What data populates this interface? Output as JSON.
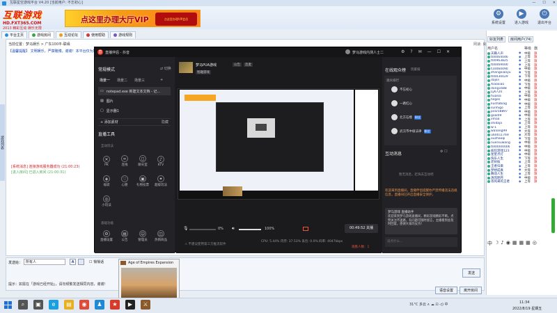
{
  "app": {
    "title": "互联星空游戏平台 V4.20 [当前用户: 不忘初心]",
    "logo_main": "互联游戏",
    "logo_sub": "HD.FXT365.COM",
    "logo_tag": "2013 精彩互动 娱乐无限",
    "vip_banner": "点这里办理大厅VIP",
    "vip_ribbon": "点这里办理VIP会员",
    "win_controls": [
      "—",
      "☐",
      "✕"
    ],
    "top_tools": [
      {
        "label": "系统设置",
        "icon": "⚙"
      },
      {
        "label": "进入游戏",
        "icon": "▶"
      },
      {
        "label": "退出平台",
        "icon": "⏻"
      }
    ]
  },
  "nav_tabs": [
    {
      "label": "平台主页",
      "color": "#2a8de0"
    },
    {
      "label": "游戏房间",
      "color": "#3aa34a"
    },
    {
      "label": "互动论坛",
      "color": "#e8a020"
    },
    {
      "label": "使用帮助",
      "color": "#d23a3a"
    },
    {
      "label": "游戏规则",
      "color": "#7a57c0"
    }
  ],
  "room": {
    "info": "当前位置：梦马娱乐 > 广东100平-联缘",
    "notice": "【温馨提醒】 文明娱乐，严禁赌博，谢谢！本平台仅为娱乐平台...",
    "chat_line1": "[系统消息] 连接游戏服务器成功 (21:00:23)",
    "chat_line2": "[进入房间] 已进入房间 (21:00:31)",
    "ping": "网速: 良",
    "left_strip": "游戏列表"
  },
  "send": {
    "to_label": "发送给：",
    "to_value": "所有人",
    "format_label": "A",
    "private_label": "悄悄话",
    "send_label": "发送",
    "tip": "提示：如需在「游戏已经开始」，请勿频繁发送相同内容，谢谢！",
    "mic_label": "语音设置",
    "exit_label": "离开房间"
  },
  "right_panel": {
    "tabs": [
      "好友列表",
      "房间用户(74)"
    ],
    "headers": [
      "用户名",
      "",
      "等级",
      "旗"
    ],
    "users": [
      {
        "name": "天籁人声",
        "level": "中级",
        "flag": "旗"
      },
      {
        "name": "t00064046",
        "level": "上等",
        "flag": "旗"
      },
      {
        "name": "t00963825",
        "level": "上等",
        "flag": "旗"
      },
      {
        "name": "t00069000",
        "level": "上等",
        "flag": "旗"
      },
      {
        "name": "t10060090",
        "level": "中级",
        "flag": "旗"
      },
      {
        "name": "zhangxiaoyu",
        "level": "下等",
        "flag": "旗"
      },
      {
        "name": "t00030029",
        "level": "下等",
        "flag": "旗"
      },
      {
        "name": "dajlin",
        "level": "中级",
        "flag": "旗"
      },
      {
        "name": "Xiaoxiao",
        "level": "下等",
        "flag": "旗"
      },
      {
        "name": "dong1688",
        "level": "中级",
        "flag": "旗"
      },
      {
        "name": "Ly6720",
        "level": "上等",
        "flag": "旗"
      },
      {
        "name": "huasia",
        "level": "中级",
        "flag": "旗"
      },
      {
        "name": "hilges",
        "level": "中级",
        "flag": "旗"
      },
      {
        "name": "liushabiag",
        "level": "中级",
        "flag": "旗"
      },
      {
        "name": "sunhigo",
        "level": "上等",
        "flag": "旗"
      },
      {
        "name": "pol258897",
        "level": "中级",
        "flag": "旗"
      },
      {
        "name": "goal09",
        "level": "中级",
        "flag": "旗"
      },
      {
        "name": "xmaa",
        "level": "上等",
        "flag": "旗"
      },
      {
        "name": "shidaja",
        "level": "上等",
        "flag": "旗"
      },
      {
        "name": "w-1",
        "level": "上等",
        "flag": "旗"
      },
      {
        "name": "waliang99",
        "level": "大等",
        "flag": "旗"
      },
      {
        "name": "u60011769",
        "level": "大等",
        "flag": "旗"
      },
      {
        "name": "ouzhaoqi",
        "level": "下等",
        "flag": "旗"
      },
      {
        "name": "nuerxuwang",
        "level": "中级",
        "flag": "旗"
      },
      {
        "name": "t000000006",
        "level": "中级",
        "flag": "旗"
      },
      {
        "name": "疯狂游戏123",
        "level": "中级",
        "flag": "旗"
      },
      {
        "name": "星星点灯",
        "level": "中级",
        "flag": "旗"
      },
      {
        "name": "快乐人生",
        "level": "下等",
        "flag": "旗"
      },
      {
        "name": "老树枝",
        "level": "上等",
        "flag": "旗"
      },
      {
        "name": "王者归来",
        "level": "上等",
        "flag": "旗"
      },
      {
        "name": "梦想成真",
        "level": "大等",
        "flag": "旗"
      },
      {
        "name": "舞动人生",
        "level": "上等",
        "flag": "旗"
      },
      {
        "name": "清风明月",
        "level": "中级",
        "flag": "旗"
      },
      {
        "name": "等风来的王者",
        "level": "上等",
        "flag": "旗"
      }
    ],
    "emoji_bar": [
      "中",
      "☽",
      "♪",
      "◉",
      "▦",
      "▦",
      "▦",
      "◎"
    ]
  },
  "stream": {
    "app_name": "直播伴侣 - 抖音",
    "user_name": "梦马游戏内测人士二",
    "win_controls": [
      "⚙",
      "?",
      "✉",
      "—",
      "☐",
      "✕"
    ],
    "mode_label": "常规模式",
    "mode_switch": "⇄ 切换",
    "scene_tabs": [
      "场景一",
      "场景二",
      "场景三",
      "+"
    ],
    "sources": [
      "notepad.exe 新建文本文档 - 记...",
      "图片",
      "显示器1"
    ],
    "add_source": "+ 添加素材",
    "add_source_right": "隐藏",
    "tools_title": "直播工具",
    "tools_sub1": "互动玩法",
    "tools_row1": [
      {
        "label": "PK",
        "icon": "✕"
      },
      {
        "label": "连线",
        "icon": "∞"
      },
      {
        "label": "聊天室",
        "icon": "◻"
      },
      {
        "label": "KTV",
        "icon": "♪"
      }
    ],
    "tools_row2": [
      {
        "label": "福袋",
        "icon": "◈"
      },
      {
        "label": "心愿",
        "icon": "♡"
      },
      {
        "label": "礼物投票",
        "icon": "▣"
      },
      {
        "label": "超级玩法",
        "icon": "✦"
      }
    ],
    "tools_row3": [
      {
        "label": "小玩法",
        "icon": "◎"
      }
    ],
    "tools_sub2": "基础功能",
    "tools_row4": [
      {
        "label": "直播设置",
        "icon": "⚙"
      },
      {
        "label": "公告",
        "icon": "▤"
      },
      {
        "label": "管理员",
        "icon": "☺"
      },
      {
        "label": "热销商品",
        "icon": "◫"
      }
    ],
    "room_title": "梦马PUA游戏",
    "room_tag1": "公告",
    "room_tag2": "连麦",
    "room_category": "智趣游戏",
    "mic_pct": "0%",
    "speaker_pct": "100%",
    "timer": "00:49:52 关播",
    "bottom_hint": "⚠ 不建议使用第三方推流软件",
    "perf_stats": "CPU: 5.44%   内存: 37.53%   丢包: 0.0%   码率: 4047kbps",
    "perf_warn": "观看人数：1",
    "online_title": "在线观众榜",
    "online_sub": "玩家排",
    "online_hdr": "观众排行",
    "online_users": [
      {
        "name": "不忘初心",
        "badge": ""
      },
      {
        "name": "一路红心",
        "badge": ""
      },
      {
        "name": "北方石榴",
        "badge": "粉丝"
      },
      {
        "name": "武汉市中级法律",
        "badge": "粉丝"
      }
    ],
    "interact_title": "互动消息",
    "interact_icons": "⚙  ☐",
    "interact_empty": "暂无消息，赶快去互动吧",
    "interact_msg1": "欢迎来到直播间，直播伴侣提醒你严禁传播违法违规信息，直播间已开启直播安全保护。",
    "card_name": "梦马游戏  直播助手",
    "card_text": "欢迎来到梦马游戏直播间，精彩游戏精彩不断。点赞关注不迷路，有问题可随时留言，主播看到会及时回复，感谢大家的支持！",
    "chat_placeholder": "说点什么..."
  },
  "taskbar": {
    "icons": [
      {
        "name": "search",
        "glyph": "⌕",
        "color": "#555"
      },
      {
        "name": "task-view",
        "glyph": "▣",
        "color": "#555"
      },
      {
        "name": "edge",
        "glyph": "e",
        "color": "#1aa0e0"
      },
      {
        "name": "explorer",
        "glyph": "▤",
        "color": "#e8b020"
      },
      {
        "name": "chrome",
        "glyph": "◉",
        "color": "#dd4b39"
      },
      {
        "name": "qq",
        "glyph": "♟",
        "color": "#1e8ad6"
      },
      {
        "name": "game",
        "glyph": "★",
        "color": "#d83a2a"
      },
      {
        "name": "stream",
        "glyph": "▶",
        "color": "#222"
      },
      {
        "name": "empires",
        "glyph": "⚔",
        "color": "#8b5a2b"
      }
    ],
    "tray": "31°C 多云  ∧  ☁  ⊡  ◁)  中",
    "time": "11:34",
    "date": "2022/8/19 星期五",
    "preview_title": "Age of Empires Expansion"
  }
}
